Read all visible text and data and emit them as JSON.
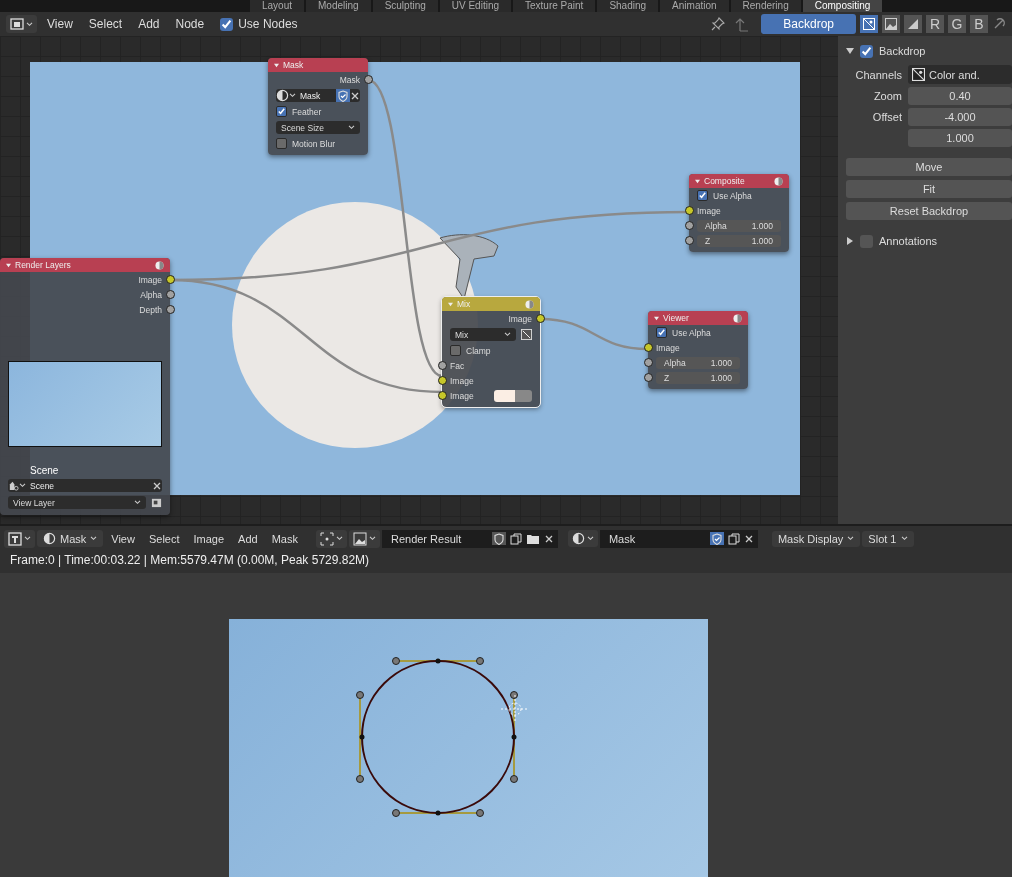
{
  "workspace_tabs": [
    {
      "label": "Layout",
      "selected": false
    },
    {
      "label": "Modeling",
      "selected": false
    },
    {
      "label": "Sculpting",
      "selected": false
    },
    {
      "label": "UV Editing",
      "selected": false
    },
    {
      "label": "Texture Paint",
      "selected": false
    },
    {
      "label": "Shading",
      "selected": false
    },
    {
      "label": "Animation",
      "selected": false
    },
    {
      "label": "Rendering",
      "selected": false
    },
    {
      "label": "Compositing",
      "selected": true
    }
  ],
  "node_editor": {
    "menus": [
      "View",
      "Select",
      "Add",
      "Node"
    ],
    "use_nodes": {
      "label": "Use Nodes",
      "checked": true
    },
    "backdrop_button": {
      "label": "Backdrop",
      "selected": true
    },
    "channel_buttons": [
      {
        "kind": "color-alpha",
        "selected": true
      },
      {
        "kind": "color",
        "selected": false
      },
      {
        "kind": "alpha",
        "selected": false
      },
      {
        "kind": "letter",
        "label": "R",
        "selected": false
      },
      {
        "kind": "letter",
        "label": "G",
        "selected": false
      },
      {
        "kind": "letter",
        "label": "B",
        "selected": false
      }
    ],
    "nodes": [
      {
        "title": "Mask",
        "color": "#b84052",
        "rows": [
          {
            "kind": "output",
            "label": "Mask",
            "color": "#a1a1a1"
          },
          {
            "kind": "datablock",
            "value": "Mask",
            "fake_user": true
          },
          {
            "kind": "checkbox",
            "label": "Feather",
            "checked": true
          },
          {
            "kind": "dropdown",
            "value": "Scene Size"
          },
          {
            "kind": "checkbox",
            "label": "Motion Blur",
            "checked": false
          }
        ]
      },
      {
        "title": "Render Layers",
        "color": "#b84052",
        "rows": [
          {
            "kind": "output",
            "label": "Image",
            "color": "#c7c729"
          },
          {
            "kind": "output",
            "label": "Alpha",
            "color": "#a1a1a1"
          },
          {
            "kind": "output",
            "label": "Depth",
            "color": "#a1a1a1"
          },
          {
            "kind": "preview"
          },
          {
            "kind": "scene",
            "label": "Scene",
            "value": "Scene"
          },
          {
            "kind": "layer",
            "value": "View Layer"
          }
        ]
      },
      {
        "title": "Composite",
        "color": "#b84052",
        "rows": [
          {
            "kind": "checkbox",
            "label": "Use Alpha",
            "checked": true
          },
          {
            "kind": "input",
            "label": "Image",
            "color": "#c7c729"
          },
          {
            "kind": "field",
            "label": "Alpha",
            "value": "1.000",
            "color": "#a1a1a1"
          },
          {
            "kind": "field",
            "label": "Z",
            "value": "1.000",
            "color": "#a1a1a1"
          }
        ]
      },
      {
        "title": "Mix",
        "color": "#b8a83e",
        "rows": [
          {
            "kind": "output",
            "label": "Image",
            "color": "#c7c729"
          },
          {
            "kind": "blend",
            "value": "Mix"
          },
          {
            "kind": "checkbox",
            "label": "Clamp",
            "checked": false
          },
          {
            "kind": "input",
            "label": "Fac",
            "color": "#a1a1a1"
          },
          {
            "kind": "input",
            "label": "Image",
            "color": "#c7c729"
          },
          {
            "kind": "color-input",
            "label": "Image",
            "color": "#c7c729"
          }
        ]
      },
      {
        "title": "Viewer",
        "color": "#b84052",
        "rows": [
          {
            "kind": "checkbox",
            "label": "Use Alpha",
            "checked": true
          },
          {
            "kind": "input",
            "label": "Image",
            "color": "#c7c729"
          },
          {
            "kind": "field",
            "label": "Alpha",
            "value": "1.000",
            "color": "#a1a1a1"
          },
          {
            "kind": "field",
            "label": "Z",
            "value": "1.000",
            "color": "#a1a1a1"
          }
        ]
      }
    ],
    "sidebar": {
      "backdrop_panel": {
        "title": "Backdrop",
        "checked": true,
        "expanded": true,
        "rows": [
          {
            "kind": "enum",
            "label": "Channels",
            "value": "Color and."
          },
          {
            "kind": "number",
            "label": "Zoom",
            "value": "0.40"
          },
          {
            "kind": "number",
            "label": "Offset",
            "value": "-4.000"
          },
          {
            "kind": "number",
            "value": "1.000"
          }
        ],
        "buttons": [
          "Move",
          "Fit",
          "Reset Backdrop"
        ]
      },
      "annotations_panel": {
        "title": "Annotations",
        "checked": false,
        "expanded": false
      }
    }
  },
  "image_editor": {
    "mode": "Mask",
    "menus": [
      "View",
      "Select",
      "Image",
      "Add",
      "Mask"
    ],
    "image": {
      "value": "Render Result",
      "fake_user": false
    },
    "mask": {
      "value": "Mask",
      "fake_user": true
    },
    "display_dropdown": "Mask Display",
    "slot_dropdown": "Slot 1",
    "info": "Frame:0 | Time:00:03.22 | Mem:5579.47M (0.00M, Peak 5729.82M)"
  }
}
